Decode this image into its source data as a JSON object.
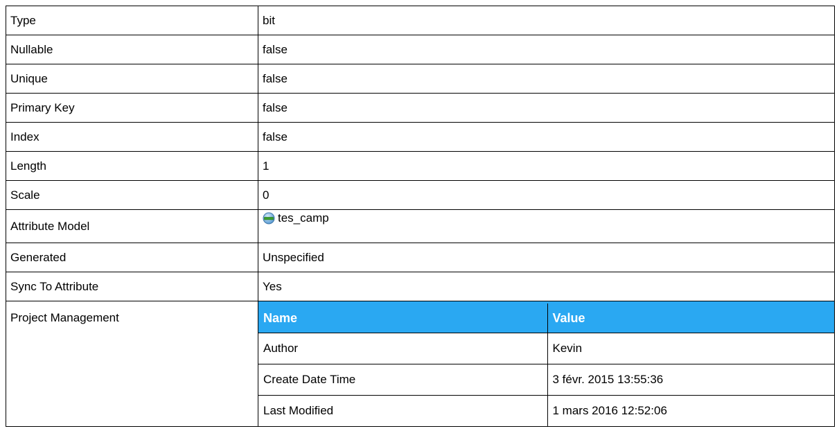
{
  "properties": [
    {
      "label": "Type",
      "value": "bit"
    },
    {
      "label": "Nullable",
      "value": "false"
    },
    {
      "label": "Unique",
      "value": "false"
    },
    {
      "label": "Primary Key",
      "value": "false"
    },
    {
      "label": "Index",
      "value": "false"
    },
    {
      "label": "Length",
      "value": "1"
    },
    {
      "label": "Scale",
      "value": "0"
    },
    {
      "label": "Attribute Model",
      "value": "tes_camp",
      "icon": "attribute-model-icon"
    },
    {
      "label": "Generated",
      "value": "Unspecified"
    },
    {
      "label": "Sync To Attribute",
      "value": "Yes"
    }
  ],
  "project_management": {
    "label": "Project Management",
    "header_color": "#2aa8f2",
    "columns": [
      "Name",
      "Value"
    ],
    "rows": [
      {
        "name": "Author",
        "value": "Kevin"
      },
      {
        "name": "Create Date Time",
        "value": "3 févr. 2015 13:55:36"
      },
      {
        "name": "Last Modified",
        "value": "1 mars 2016 12:52:06"
      }
    ]
  }
}
